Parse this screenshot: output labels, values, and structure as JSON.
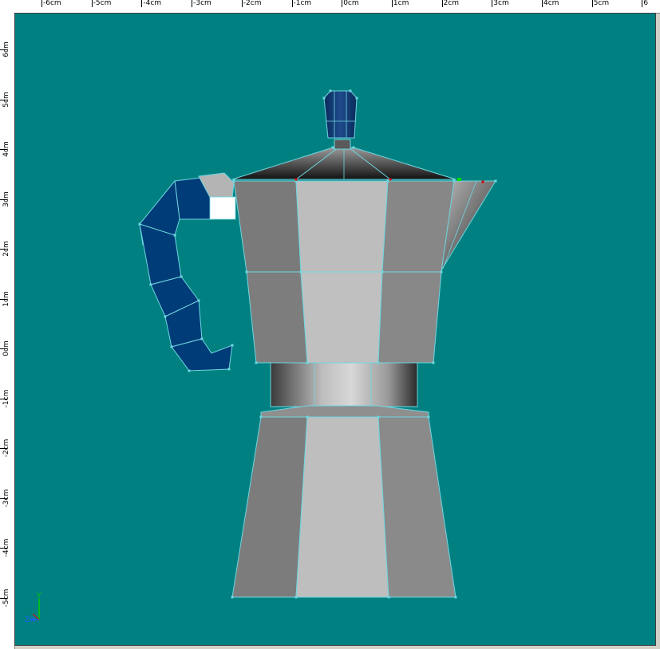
{
  "viewport": {
    "background": "#008080",
    "wire_color": "#6fd6e0",
    "handle_color": "#003c78",
    "body_light": "#bebebe",
    "body_dark": "#7c7c7c"
  },
  "top_ruler": {
    "labels": [
      "-6cm",
      "-5cm",
      "-4cm",
      "-3cm",
      "-2cm",
      "-1cm",
      "0cm",
      "1cm",
      "2cm",
      "3cm",
      "4cm",
      "5cm",
      "6"
    ]
  },
  "left_ruler": {
    "labels": [
      "6cm",
      "5cm",
      "4cm",
      "3cm",
      "2cm",
      "1cm",
      "0cm",
      "-1cm",
      "-2cm",
      "-3cm",
      "-4cm",
      "-5cm"
    ]
  },
  "axis_gizmo": {
    "y_label": "Y",
    "x_label": "X",
    "z_label": "Z"
  }
}
